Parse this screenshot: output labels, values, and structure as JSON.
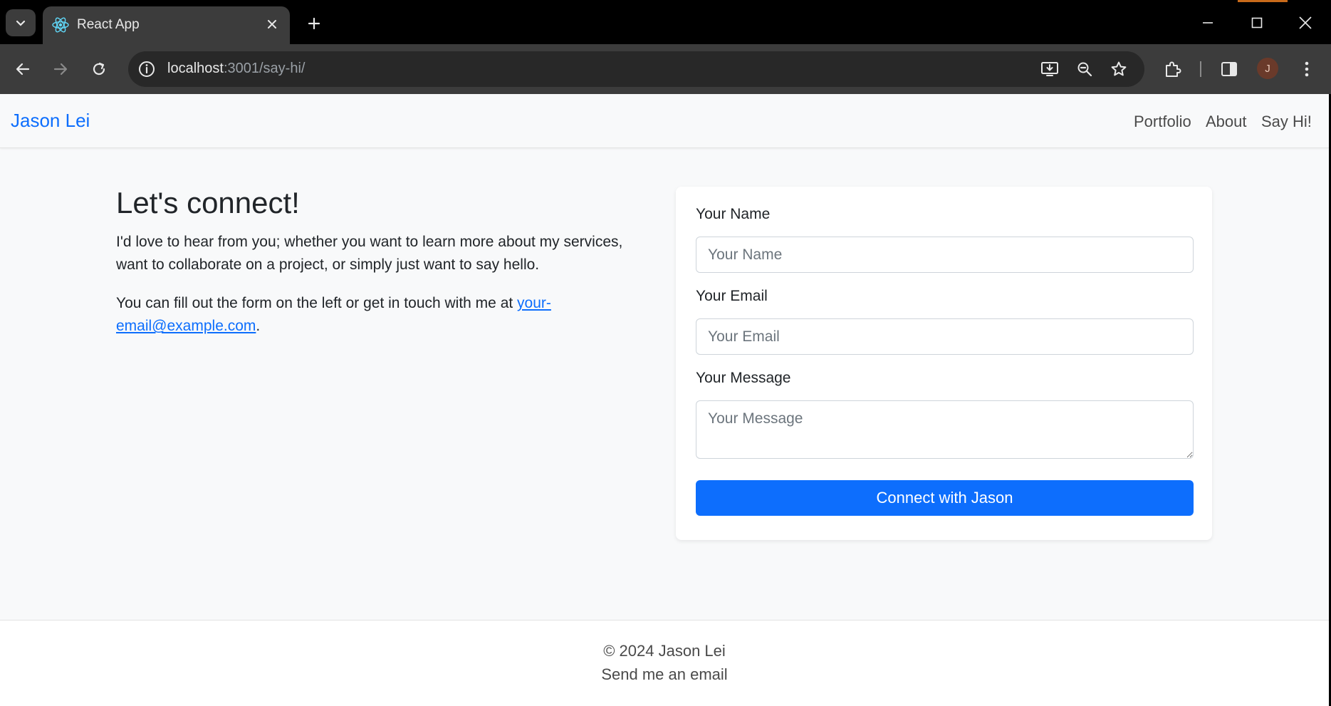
{
  "browser": {
    "tab": {
      "title": "React App"
    },
    "address": {
      "host": "localhost",
      "path": ":3001/say-hi/"
    },
    "profile_initial": "J",
    "icons": [
      "tab-search-icon",
      "react-logo-icon",
      "close-icon",
      "plus-icon",
      "minimize-icon",
      "maximize-icon",
      "close-window-icon",
      "back-arrow-icon",
      "forward-arrow-icon",
      "reload-icon",
      "site-info-icon",
      "install-app-icon",
      "zoom-icon",
      "bookmark-star-icon",
      "extensions-icon",
      "side-panel-icon",
      "more-vert-icon"
    ]
  },
  "navbar": {
    "brand": "Jason Lei",
    "links": [
      {
        "label": "Portfolio"
      },
      {
        "label": "About"
      },
      {
        "label": "Say Hi!"
      }
    ]
  },
  "intro": {
    "heading": "Let's connect!",
    "paragraph1": "I'd love to hear from you; whether you want to learn more about my services, want to collaborate on a project, or simply just want to say hello.",
    "paragraph2_prefix": "You can fill out the form on the left or get in touch with me at ",
    "email_link": "your-email@example.com",
    "paragraph2_suffix": "."
  },
  "form": {
    "name_label": "Your Name",
    "name_placeholder": "Your Name",
    "email_label": "Your Email",
    "email_placeholder": "Your Email",
    "message_label": "Your Message",
    "message_placeholder": "Your Message",
    "submit_label": "Connect with Jason"
  },
  "footer": {
    "copyright": "© 2024 Jason Lei",
    "email_link": "Send me an email"
  },
  "colors": {
    "accent": "#0d6efd",
    "page_bg": "#f8f9fa",
    "chrome_bg": "#3c3c3c"
  }
}
